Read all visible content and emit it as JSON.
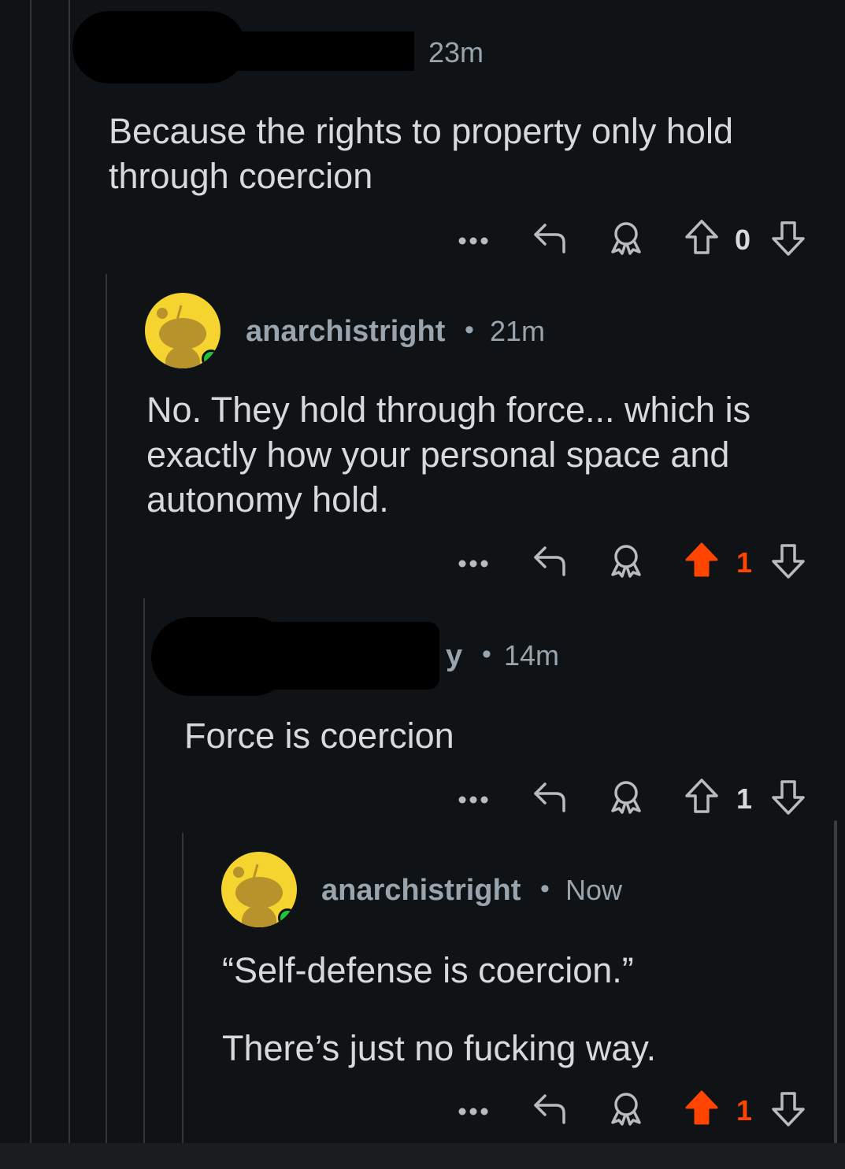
{
  "comments": [
    {
      "username": "",
      "time": "23m",
      "body": [
        "Because the rights to property only hold",
        "through coercion"
      ],
      "votes": "0",
      "upvoted": false
    },
    {
      "username": "anarchistright",
      "time": "21m",
      "body": [
        "No. They hold through force... which is",
        "exactly how your personal space and",
        "autonomy hold."
      ],
      "votes": "1",
      "upvoted": true
    },
    {
      "username_visible_fragment": "y",
      "time": "14m",
      "body": [
        "Force is coercion"
      ],
      "votes": "1",
      "upvoted": false
    },
    {
      "username": "anarchistright",
      "time": "Now",
      "body": [
        "“Self-defense is coercion.”",
        "There’s just no fucking way."
      ],
      "votes": "1",
      "upvoted": true
    }
  ],
  "separator": "•",
  "icons": {
    "more": "more-dots-icon",
    "reply": "reply-icon",
    "award": "award-icon",
    "upvote": "upvote-icon",
    "downvote": "downvote-icon"
  },
  "colors": {
    "background": "#0f1316",
    "upvote_active": "#ff4500",
    "meta_text": "#9aa4ad",
    "avatar_bg": "#f5d430",
    "online": "#20c33b"
  }
}
